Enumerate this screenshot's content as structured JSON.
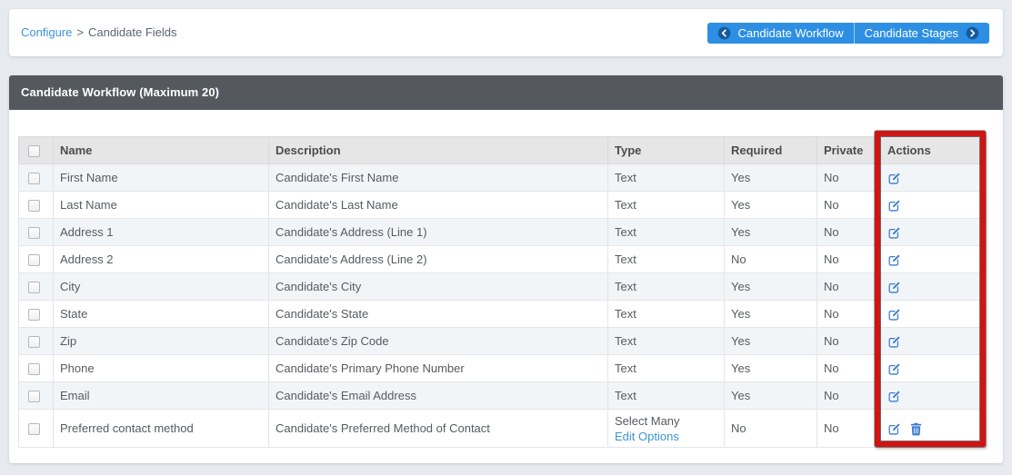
{
  "breadcrumb": {
    "link": "Configure",
    "separator": ">",
    "current": "Candidate Fields"
  },
  "nav": {
    "prev_label": "Candidate Workflow",
    "next_label": "Candidate Stages"
  },
  "panel": {
    "title": "Candidate Workflow (Maximum 20)"
  },
  "table": {
    "headers": {
      "name": "Name",
      "description": "Description",
      "type": "Type",
      "required": "Required",
      "private": "Private",
      "actions": "Actions"
    },
    "rows": [
      {
        "name": "First Name",
        "description": "Candidate's First Name",
        "type": "Text",
        "required": "Yes",
        "private": "No",
        "actions": [
          "edit"
        ]
      },
      {
        "name": "Last Name",
        "description": "Candidate's Last Name",
        "type": "Text",
        "required": "Yes",
        "private": "No",
        "actions": [
          "edit"
        ]
      },
      {
        "name": "Address 1",
        "description": "Candidate's Address (Line 1)",
        "type": "Text",
        "required": "Yes",
        "private": "No",
        "actions": [
          "edit"
        ]
      },
      {
        "name": "Address 2",
        "description": "Candidate's Address (Line 2)",
        "type": "Text",
        "required": "No",
        "private": "No",
        "actions": [
          "edit"
        ]
      },
      {
        "name": "City",
        "description": "Candidate's City",
        "type": "Text",
        "required": "Yes",
        "private": "No",
        "actions": [
          "edit"
        ]
      },
      {
        "name": "State",
        "description": "Candidate's State",
        "type": "Text",
        "required": "Yes",
        "private": "No",
        "actions": [
          "edit"
        ]
      },
      {
        "name": "Zip",
        "description": "Candidate's Zip Code",
        "type": "Text",
        "required": "Yes",
        "private": "No",
        "actions": [
          "edit"
        ]
      },
      {
        "name": "Phone",
        "description": "Candidate's Primary Phone Number",
        "type": "Text",
        "required": "Yes",
        "private": "No",
        "actions": [
          "edit"
        ]
      },
      {
        "name": "Email",
        "description": "Candidate's Email Address",
        "type": "Text",
        "required": "Yes",
        "private": "No",
        "actions": [
          "edit"
        ]
      },
      {
        "name": "Preferred contact method",
        "description": "Candidate's Preferred Method of Contact",
        "type": "Select Many",
        "type_link": "Edit Options",
        "required": "No",
        "private": "No",
        "actions": [
          "edit",
          "delete"
        ]
      }
    ],
    "icons": {
      "edit": "edit-icon",
      "delete": "trash-icon"
    }
  },
  "colors": {
    "accent_blue": "#2d8fe4",
    "link_blue": "#3d93d8",
    "icon_blue": "#3b7ccd",
    "highlight_red": "#ce1513",
    "panel_header_bg": "#55595f",
    "page_bg": "#e7ebf0"
  }
}
